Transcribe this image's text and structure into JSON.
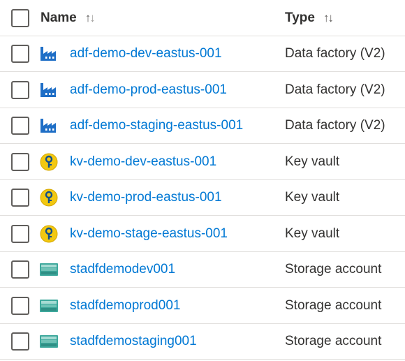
{
  "header": {
    "name_label": "Name",
    "name_sort": "↑↓",
    "type_label": "Type",
    "type_sort": "↑↓"
  },
  "rows": [
    {
      "name": "adf-demo-dev-eastus-001",
      "type": "Data factory (V2)",
      "icon": "data-factory-icon"
    },
    {
      "name": "adf-demo-prod-eastus-001",
      "type": "Data factory (V2)",
      "icon": "data-factory-icon"
    },
    {
      "name": "adf-demo-staging-eastus-001",
      "type": "Data factory (V2)",
      "icon": "data-factory-icon"
    },
    {
      "name": "kv-demo-dev-eastus-001",
      "type": "Key vault",
      "icon": "key-vault-icon"
    },
    {
      "name": "kv-demo-prod-eastus-001",
      "type": "Key vault",
      "icon": "key-vault-icon"
    },
    {
      "name": "kv-demo-stage-eastus-001",
      "type": "Key vault",
      "icon": "key-vault-icon"
    },
    {
      "name": "stadfdemodev001",
      "type": "Storage account",
      "icon": "storage-account-icon"
    },
    {
      "name": "stadfdemoprod001",
      "type": "Storage account",
      "icon": "storage-account-icon"
    },
    {
      "name": "stadfdemostaging001",
      "type": "Storage account",
      "icon": "storage-account-icon"
    }
  ],
  "colors": {
    "link": "#0078d4",
    "factory": "#1e6ec6",
    "key": "#f2c811",
    "storage": "#3ea89c"
  }
}
